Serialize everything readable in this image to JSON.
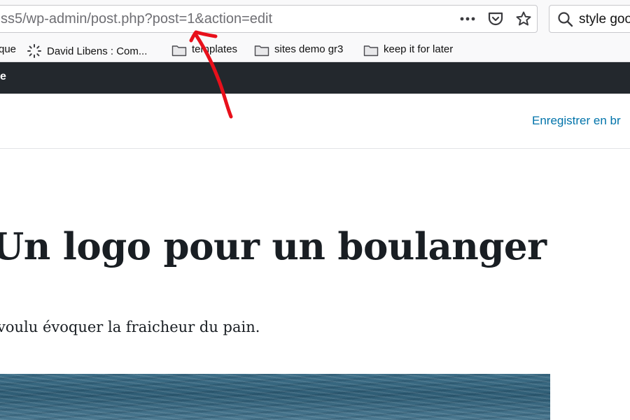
{
  "browser": {
    "url": "ss5/wp-admin/post.php?post=1&action=edit",
    "search_text": "style goo",
    "bookmarks": [
      {
        "label": "que",
        "icon": "bookmark-partial"
      },
      {
        "label": "David Libens : Com...",
        "icon": "loading-spinner-icon"
      },
      {
        "label": "templates",
        "icon": "folder-icon"
      },
      {
        "label": "sites demo gr3",
        "icon": "folder-icon"
      },
      {
        "label": "keep it for later",
        "icon": "folder-icon"
      }
    ]
  },
  "wp": {
    "adminbar_label": "e",
    "save_draft_label": "Enregistrer en br",
    "post_title": "Un logo pour un boulanger",
    "post_paragraph": "voulu évoquer la fraicheur du pain."
  },
  "colors": {
    "adminbar": "#23282d",
    "link": "#0073aa",
    "annotation": "#e8101b"
  }
}
